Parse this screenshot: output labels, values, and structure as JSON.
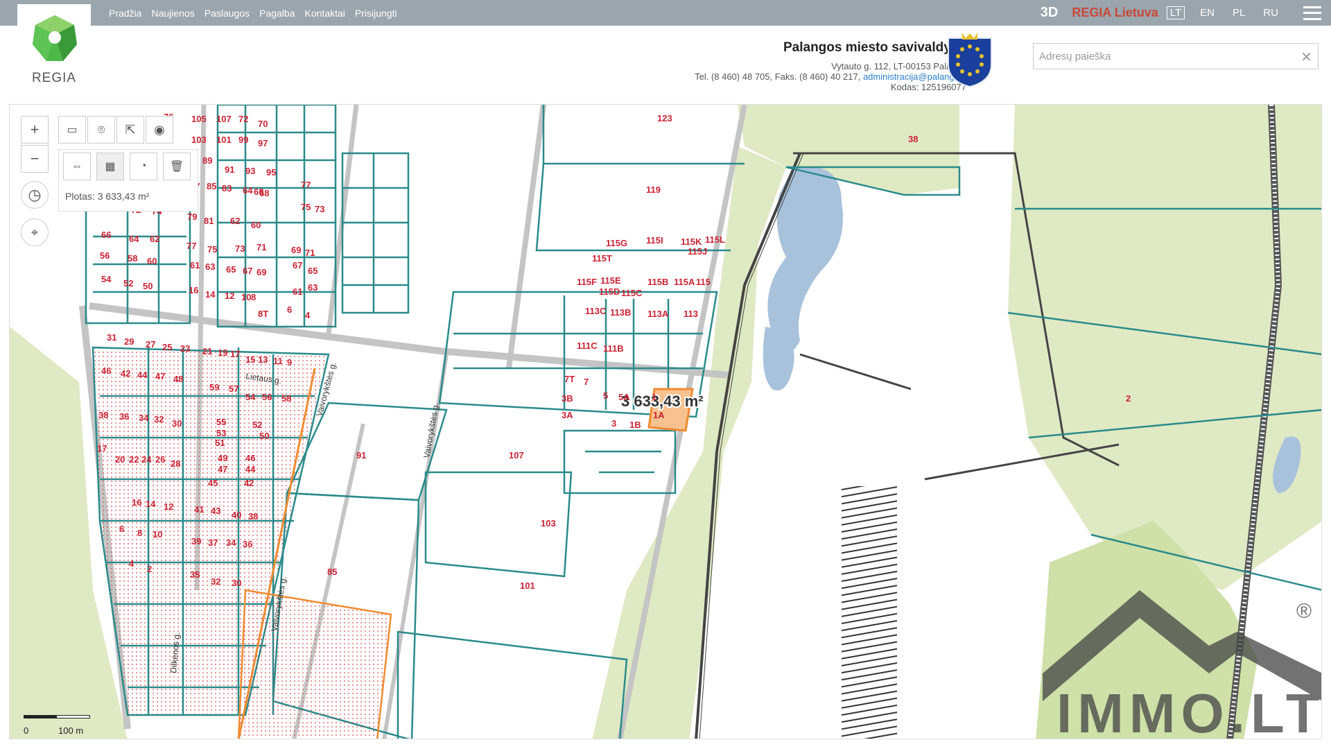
{
  "nav": {
    "items": [
      "Pradžia",
      "Naujienos",
      "Paslaugos",
      "Pagalba",
      "Kontaktai",
      "Prisijungti"
    ],
    "btn_3d": "3D",
    "regia_lt": "REGIA Lietuva",
    "langs": [
      "LT",
      "EN",
      "PL",
      "RU"
    ],
    "active_lang": "LT"
  },
  "logo": {
    "text": "REGIA"
  },
  "municipality": {
    "name": "Palangos miesto savivaldybė",
    "address": "Vytauto g. 112, LT-00153 Palanga",
    "phone": "Tel. (8 460) 48 705, Faks. (8 460) 40 217,",
    "email": "administracija@palanga.lt",
    "code": "Kodas: 125196077"
  },
  "search": {
    "placeholder": "Adresų paieška",
    "clear": "✕"
  },
  "tools": {
    "zoom_in": "+",
    "zoom_out": "−",
    "area_label": "Plotas: 3 633,43 m²"
  },
  "map": {
    "measure_label": "3 633,43 m²",
    "scale": {
      "start": "0",
      "end": "100 m"
    },
    "streets": [
      "Lietaus g.",
      "Vaivorykštės g.",
      "Vaivorykštės g.",
      "Dilkėnos g.",
      "Vaivorykštės g."
    ],
    "watermark": "IMMO.LT",
    "registered": "®",
    "parcels": [
      {
        "label": "76"
      },
      {
        "label": "105"
      },
      {
        "label": "107"
      },
      {
        "label": "72"
      },
      {
        "label": "70"
      },
      {
        "label": "103"
      },
      {
        "label": "101"
      },
      {
        "label": "99"
      },
      {
        "label": "97"
      },
      {
        "label": "89"
      },
      {
        "label": "91"
      },
      {
        "label": "93"
      },
      {
        "label": "95"
      },
      {
        "label": "87"
      },
      {
        "label": "85"
      },
      {
        "label": "83"
      },
      {
        "label": "64"
      },
      {
        "label": "66"
      },
      {
        "label": "68"
      },
      {
        "label": "77"
      },
      {
        "label": "75"
      },
      {
        "label": "73"
      },
      {
        "label": "68"
      },
      {
        "label": "72"
      },
      {
        "label": "74"
      },
      {
        "label": "79"
      },
      {
        "label": "81"
      },
      {
        "label": "62"
      },
      {
        "label": "60"
      },
      {
        "label": "66"
      },
      {
        "label": "64"
      },
      {
        "label": "62"
      },
      {
        "label": "77"
      },
      {
        "label": "75"
      },
      {
        "label": "73"
      },
      {
        "label": "71"
      },
      {
        "label": "69"
      },
      {
        "label": "71"
      },
      {
        "label": "56"
      },
      {
        "label": "58"
      },
      {
        "label": "60"
      },
      {
        "label": "61"
      },
      {
        "label": "63"
      },
      {
        "label": "65"
      },
      {
        "label": "67"
      },
      {
        "label": "69"
      },
      {
        "label": "67"
      },
      {
        "label": "65"
      },
      {
        "label": "54"
      },
      {
        "label": "52"
      },
      {
        "label": "50"
      },
      {
        "label": "16"
      },
      {
        "label": "14"
      },
      {
        "label": "12"
      },
      {
        "label": "10"
      },
      {
        "label": "8"
      },
      {
        "label": "61"
      },
      {
        "label": "63"
      },
      {
        "label": "6"
      },
      {
        "label": "4"
      },
      {
        "label": "8T"
      },
      {
        "label": "123"
      },
      {
        "label": "38"
      },
      {
        "label": "119"
      },
      {
        "label": "115G"
      },
      {
        "label": "115I"
      },
      {
        "label": "115K"
      },
      {
        "label": "115L"
      },
      {
        "label": "115J"
      },
      {
        "label": "115T"
      },
      {
        "label": "115F"
      },
      {
        "label": "115E"
      },
      {
        "label": "115D"
      },
      {
        "label": "115C"
      },
      {
        "label": "115B"
      },
      {
        "label": "115A"
      },
      {
        "label": "115"
      },
      {
        "label": "113C"
      },
      {
        "label": "113B"
      },
      {
        "label": "113A"
      },
      {
        "label": "113"
      },
      {
        "label": "111C"
      },
      {
        "label": "111B"
      },
      {
        "label": "7T"
      },
      {
        "label": "7"
      },
      {
        "label": "5"
      },
      {
        "label": "5A"
      },
      {
        "label": "1"
      },
      {
        "label": "3B"
      },
      {
        "label": "3A"
      },
      {
        "label": "1A"
      },
      {
        "label": "3"
      },
      {
        "label": "1B"
      },
      {
        "label": "107"
      },
      {
        "label": "91"
      },
      {
        "label": "103"
      },
      {
        "label": "85"
      },
      {
        "label": "101"
      },
      {
        "label": "2"
      },
      {
        "label": "31"
      },
      {
        "label": "29"
      },
      {
        "label": "27"
      },
      {
        "label": "25"
      },
      {
        "label": "23"
      },
      {
        "label": "21"
      },
      {
        "label": "19"
      },
      {
        "label": "17"
      },
      {
        "label": "15"
      },
      {
        "label": "13"
      },
      {
        "label": "11"
      },
      {
        "label": "9"
      },
      {
        "label": "46"
      },
      {
        "label": "42"
      },
      {
        "label": "44"
      },
      {
        "label": "47"
      },
      {
        "label": "48"
      },
      {
        "label": "59"
      },
      {
        "label": "57"
      },
      {
        "label": "54"
      },
      {
        "label": "56"
      },
      {
        "label": "58"
      },
      {
        "label": "38"
      },
      {
        "label": "36"
      },
      {
        "label": "34"
      },
      {
        "label": "32"
      },
      {
        "label": "30"
      },
      {
        "label": "55"
      },
      {
        "label": "53"
      },
      {
        "label": "52"
      },
      {
        "label": "50"
      },
      {
        "label": "51"
      },
      {
        "label": "17"
      },
      {
        "label": "20"
      },
      {
        "label": "22"
      },
      {
        "label": "24"
      },
      {
        "label": "26"
      },
      {
        "label": "28"
      },
      {
        "label": "49"
      },
      {
        "label": "46"
      },
      {
        "label": "47"
      },
      {
        "label": "44"
      },
      {
        "label": "45"
      },
      {
        "label": "42"
      },
      {
        "label": "16"
      },
      {
        "label": "14"
      },
      {
        "label": "12"
      },
      {
        "label": "41"
      },
      {
        "label": "43"
      },
      {
        "label": "40"
      },
      {
        "label": "38"
      },
      {
        "label": "6"
      },
      {
        "label": "8"
      },
      {
        "label": "10"
      },
      {
        "label": "39"
      },
      {
        "label": "37"
      },
      {
        "label": "34"
      },
      {
        "label": "36"
      },
      {
        "label": "4"
      },
      {
        "label": "2"
      },
      {
        "label": "35"
      },
      {
        "label": "32"
      },
      {
        "label": "30"
      }
    ]
  },
  "colors": {
    "parcel_line": "#2a8a8a",
    "parcel_label": "#cc2233",
    "selected_fill": "#f8c290",
    "selected_stroke": "#f08a30",
    "forest": "#d9e6b8",
    "water": "#a9c2dc",
    "road": "#bcbcbc"
  }
}
